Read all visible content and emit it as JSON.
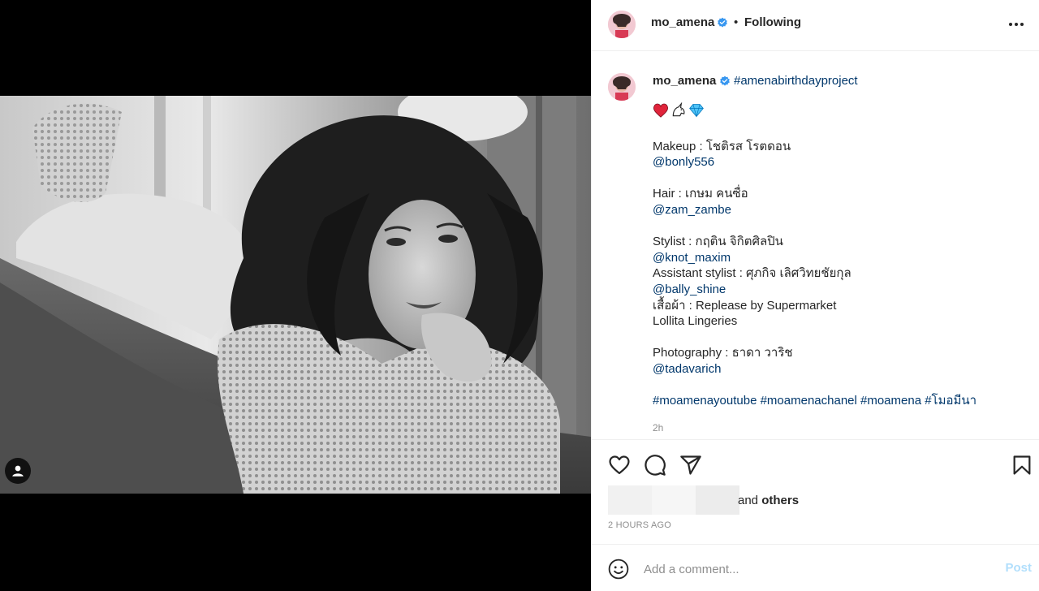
{
  "post": {
    "username": "mo_amena",
    "follow_status": "Following",
    "header_separator": "•",
    "more_icon": "more-horizontal-icon",
    "photo": {
      "description_icon": "portrait-photo",
      "user_tag_icon": "user-tag-icon"
    }
  },
  "caption": {
    "username": "mo_amena",
    "first_hashtag": "#amenabirthdayproject",
    "emojis": [
      "❤",
      "🦄",
      "💎"
    ],
    "lines": [
      {
        "text": "Makeup : โชติรส โรตดอน",
        "type": "text"
      },
      {
        "text": "@bonly556",
        "type": "link"
      },
      {
        "text": "",
        "type": "gap"
      },
      {
        "text": "Hair : เกษม คนซื่อ",
        "type": "text"
      },
      {
        "text": "@zam_zambe",
        "type": "link"
      },
      {
        "text": "",
        "type": "gap"
      },
      {
        "text": "Stylist : กฤติน จิกิตศิลปิน",
        "type": "text"
      },
      {
        "text": "@knot_maxim",
        "type": "link"
      },
      {
        "text": "Assistant stylist : ศุภกิจ เลิศวิทยชัยกุล",
        "type": "text"
      },
      {
        "text": "@bally_shine",
        "type": "link"
      },
      {
        "text": "เสื้อผ้า : Replease by Supermarket",
        "type": "text"
      },
      {
        "text": "Lollita Lingeries",
        "type": "text"
      },
      {
        "text": "",
        "type": "gap"
      },
      {
        "text": "Photography : ธาดา วาริช",
        "type": "text"
      },
      {
        "text": "@tadavarich",
        "type": "link"
      },
      {
        "text": "",
        "type": "gap"
      },
      {
        "text": "#moamenayoutube #moamenachanel #moamena #โมอมีนา",
        "type": "link"
      }
    ],
    "time_ago": "2h"
  },
  "actions": {
    "like_icon": "heart-icon",
    "comment_icon": "comment-icon",
    "share_icon": "share-icon",
    "save_icon": "bookmark-icon"
  },
  "likes": {
    "and": "and",
    "others": "others"
  },
  "timestamp": "2 HOURS AGO",
  "comment": {
    "emoji_icon": "smiley-icon",
    "placeholder": "Add a comment...",
    "post_label": "Post"
  },
  "colors": {
    "link": "#00376b",
    "verified": "#3897f0",
    "post_disabled": "#b2dffc",
    "muted": "#8e8e8e"
  }
}
